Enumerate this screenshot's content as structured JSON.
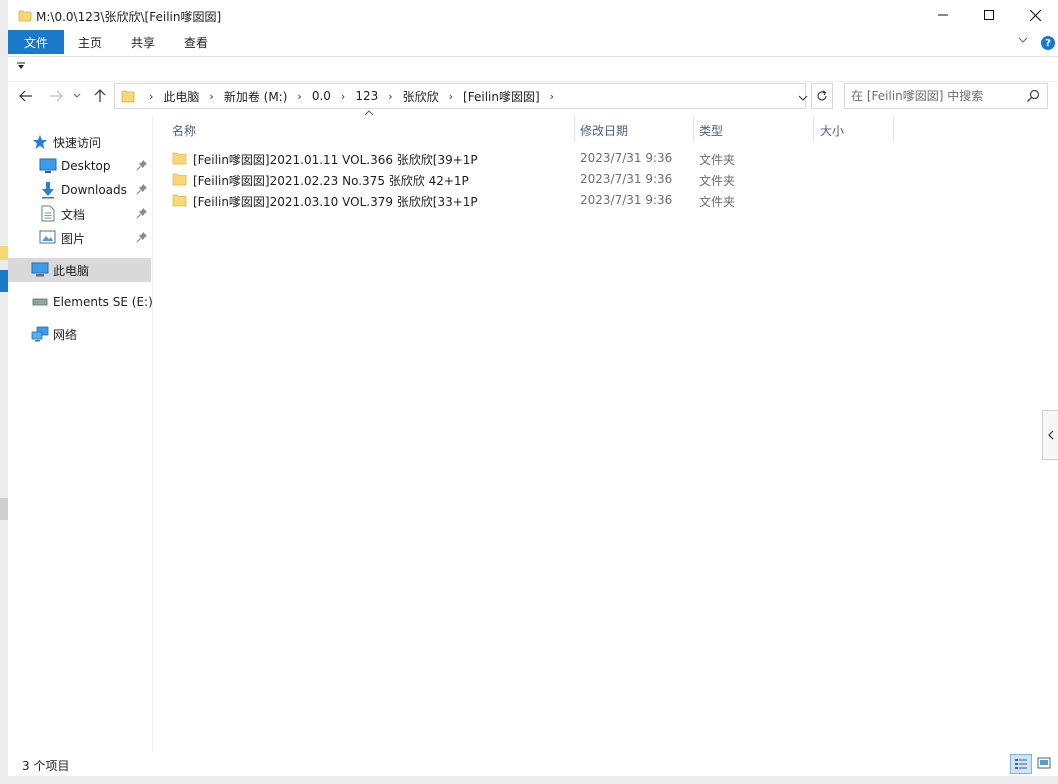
{
  "window": {
    "title": "M:\\0.0\\123\\张欣欣\\[Feilin嗲囡囡]",
    "controls": {
      "minimize": "—",
      "maximize": "☐",
      "close": "✕"
    }
  },
  "ribbon": {
    "file": "文件",
    "home": "主页",
    "share": "共享",
    "view": "查看",
    "help": "?"
  },
  "address_bar": {
    "crumbs": [
      "此电脑",
      "新加卷 (M:)",
      "0.0",
      "123",
      "张欣欣",
      "[Feilin嗲囡囡]"
    ]
  },
  "search": {
    "placeholder": "在 [Feilin嗲囡囡] 中搜索"
  },
  "nav_pane": {
    "quick_access": "快速访问",
    "desktop": "Desktop",
    "downloads": "Downloads",
    "documents": "文档",
    "pictures": "图片",
    "this_pc": "此电脑",
    "drive_e": "Elements SE (E:)",
    "network": "网络"
  },
  "columns": {
    "name": "名称",
    "date": "修改日期",
    "type": "类型",
    "size": "大小"
  },
  "files": [
    {
      "name": "[Feilin嗲囡囡]2021.01.11 VOL.366 张欣欣[39+1P",
      "date": "2023/7/31 9:36",
      "type": "文件夹"
    },
    {
      "name": "[Feilin嗲囡囡]2021.02.23 No.375 张欣欣 42+1P",
      "date": "2023/7/31 9:36",
      "type": "文件夹"
    },
    {
      "name": "[Feilin嗲囡囡]2021.03.10 VOL.379 张欣欣[33+1P",
      "date": "2023/7/31 9:36",
      "type": "文件夹"
    }
  ],
  "status": {
    "item_count": "3 个项目"
  },
  "colors": {
    "accent": "#1979ca",
    "folder": "#f8d775",
    "selected_bg": "#d9d9d9"
  }
}
